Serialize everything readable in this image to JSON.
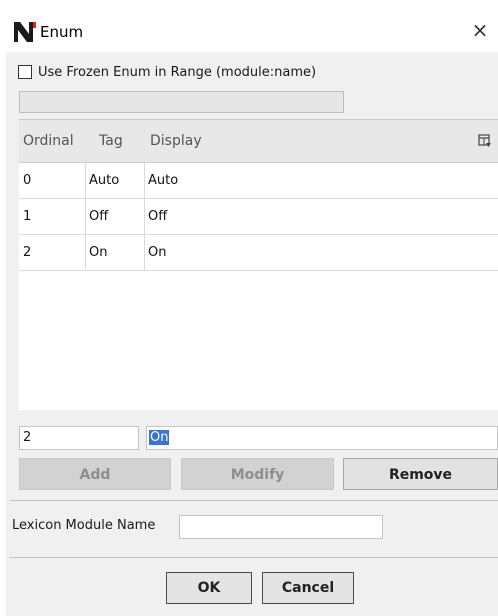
{
  "window": {
    "title": "Enum",
    "close_glyph": "×",
    "logo_icon": "niagara-n-icon",
    "logo_color": "#1a1a1a",
    "logo_accent": "#e2231a"
  },
  "frozen": {
    "label": "Use Frozen Enum in Range (module:name)",
    "checked": false,
    "range_value": ""
  },
  "table": {
    "columns": [
      "Ordinal",
      "Tag",
      "Display"
    ],
    "rows": [
      {
        "ordinal": "0",
        "tag": "Auto",
        "display": "Auto"
      },
      {
        "ordinal": "1",
        "tag": "Off",
        "display": "Off"
      },
      {
        "ordinal": "2",
        "tag": "On",
        "display": "On"
      }
    ],
    "column_chooser_icon": "column-chooser-icon"
  },
  "edit": {
    "ordinal_value": "2",
    "display_value": "On"
  },
  "buttons": {
    "add": "Add",
    "modify": "Modify",
    "remove": "Remove",
    "ok": "OK",
    "cancel": "Cancel"
  },
  "lexicon": {
    "label": "Lexicon Module Name",
    "value": ""
  }
}
